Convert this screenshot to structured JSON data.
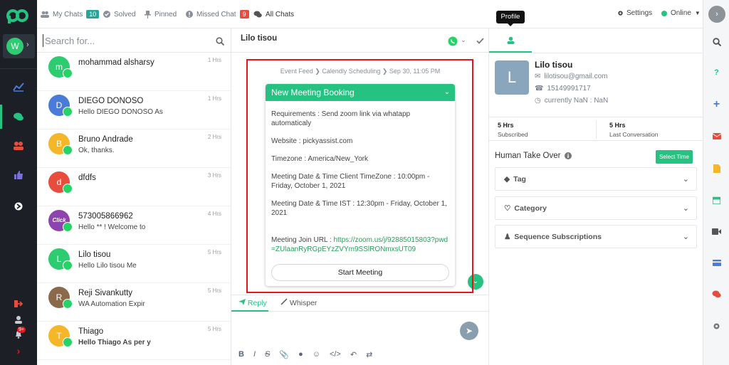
{
  "tabs": [
    {
      "label": "My Chats",
      "count": "10",
      "count_color": "#26a69a"
    },
    {
      "label": "Solved"
    },
    {
      "label": "Pinned"
    },
    {
      "label": "Missed Chat",
      "count": "9",
      "count_color": "#e74c3c"
    },
    {
      "label": "All Chats"
    }
  ],
  "header": {
    "settings_label": "Settings",
    "status_label": "Online",
    "tooltip": "Profile"
  },
  "workspace": {
    "initial": "W"
  },
  "rail": {
    "badge": "9+"
  },
  "search": {
    "placeholder": "Search for..."
  },
  "chats": [
    {
      "initial": "m",
      "name": "mohammad alsharsy",
      "preview": "",
      "time": "1 Hrs",
      "color": "#2ecc71"
    },
    {
      "initial": "D",
      "name": "DIEGO DONOSO",
      "preview": "Hello DIEGO DONOSO As",
      "time": "1 Hrs",
      "color": "#4a7bd8"
    },
    {
      "initial": "B",
      "name": "Bruno Andrade",
      "preview": "Ok, thanks.",
      "time": "2 Hrs",
      "color": "#f5b62a"
    },
    {
      "initial": "d",
      "name": "dfdfs",
      "preview": "",
      "time": "3 Hrs",
      "color": "#e74c3c"
    },
    {
      "initial": "Click",
      "name": "573005866962",
      "preview": "Hello ** ! Welcome to",
      "time": "4 Hrs",
      "color": "#8e44ad"
    },
    {
      "initial": "L",
      "name": "Lilo tisou",
      "preview": "Hello Lilo tisou Me",
      "time": "5 Hrs",
      "color": "#2ecc71"
    },
    {
      "initial": "R",
      "name": "Reji Sivankutty",
      "preview": "WA Automation Expir",
      "time": "5 Hrs",
      "color": "#8a6a4a"
    },
    {
      "initial": "T",
      "name": "Thiago",
      "preview": "Hello Thiago As per y",
      "time": "5 Hrs",
      "color": "#f5b62a"
    }
  ],
  "conversation": {
    "name": "Lilo tisou",
    "breadcrumb": "Event Feed ❯ Calendly Scheduling ❯ Sep 30, 11:05 PM",
    "card": {
      "title": "New Meeting Booking",
      "requirements": "Requirements :  Send zoom link via whatapp automaticaly",
      "website": "Website :  pickyassist.com",
      "timezone": "Timezone :  America/New_York",
      "client_time": "Meeting Date & Time Client TimeZone :  10:00pm - Friday, October 1, 2021",
      "ist_time": "Meeting Date & Time IST :  12:30pm - Friday, October 1, 2021",
      "join_label": "Meeting Join URL :  ",
      "join_url": "https://zoom.us/j/92885015803?pwd=ZUlaanRyRGpEYzZVYm9SSlRONmxsUT09",
      "button": "Start Meeting"
    },
    "reply_tab": "Reply",
    "whisper_tab": "Whisper"
  },
  "profile": {
    "initial": "L",
    "name": "Lilo tisou",
    "email": "lilotisou@gmail.com",
    "phone": "15149991717",
    "time": "currently NaN : NaN",
    "subscribed_value": "5 Hrs",
    "subscribed_label": "Subscribed",
    "last_value": "5 Hrs",
    "last_label": "Last Conversation",
    "human_takeover": "Human Take Over",
    "select_time": "Select Time",
    "tag": "Tag",
    "category": "Category",
    "sequence": "Sequence Subscriptions"
  },
  "colors": {
    "accent": "#26c281",
    "highlight_border": "#e8141b",
    "rail_bg": "#1c2026"
  }
}
